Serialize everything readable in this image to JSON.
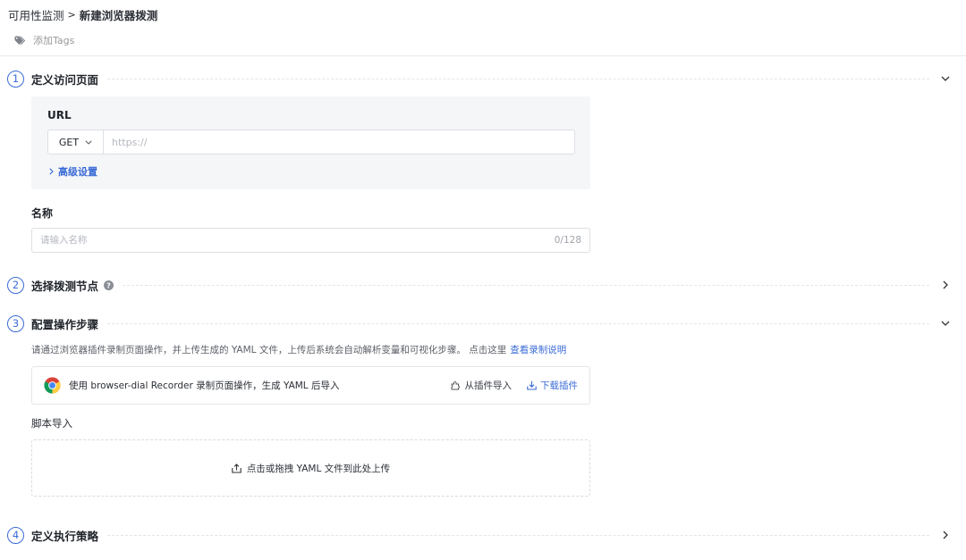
{
  "breadcrumb": {
    "root": "可用性监测",
    "separator": ">",
    "current": "新建浏览器拨测"
  },
  "tags": {
    "label": "添加Tags",
    "icon": "tag-icon"
  },
  "sections": [
    {
      "number": "1",
      "title": "定义访问页面",
      "expanded": true
    },
    {
      "number": "2",
      "title": "选择拨测节点",
      "expanded": false,
      "has_help": true
    },
    {
      "number": "3",
      "title": "配置操作步骤",
      "expanded": true
    },
    {
      "number": "4",
      "title": "定义执行策略",
      "expanded": false
    }
  ],
  "url": {
    "label": "URL",
    "method": "GET",
    "value": "",
    "placeholder": "https://",
    "advanced_label": "高级设置"
  },
  "name": {
    "label": "名称",
    "value": "",
    "placeholder": "请输入名称",
    "counter": "0/128"
  },
  "steps": {
    "description": "请通过浏览器插件录制页面操作，并上传生成的 YAML 文件，上传后系统会自动解析变量和可视化步骤。 点击这里",
    "description_link": "查看录制说明",
    "recorder_text": "使用 browser-dial Recorder 录制页面操作，生成 YAML 后导入",
    "import_label": "从插件导入",
    "download_label": "下载插件",
    "script_label": "脚本导入",
    "upload_label": "点击或拖拽 YAML 文件到此处上传"
  },
  "colors": {
    "accent": "#3b6bd6",
    "text": "#1f2329",
    "muted": "#b4b8bf",
    "panel": "#f5f6f8",
    "border": "#dcdfe4"
  }
}
